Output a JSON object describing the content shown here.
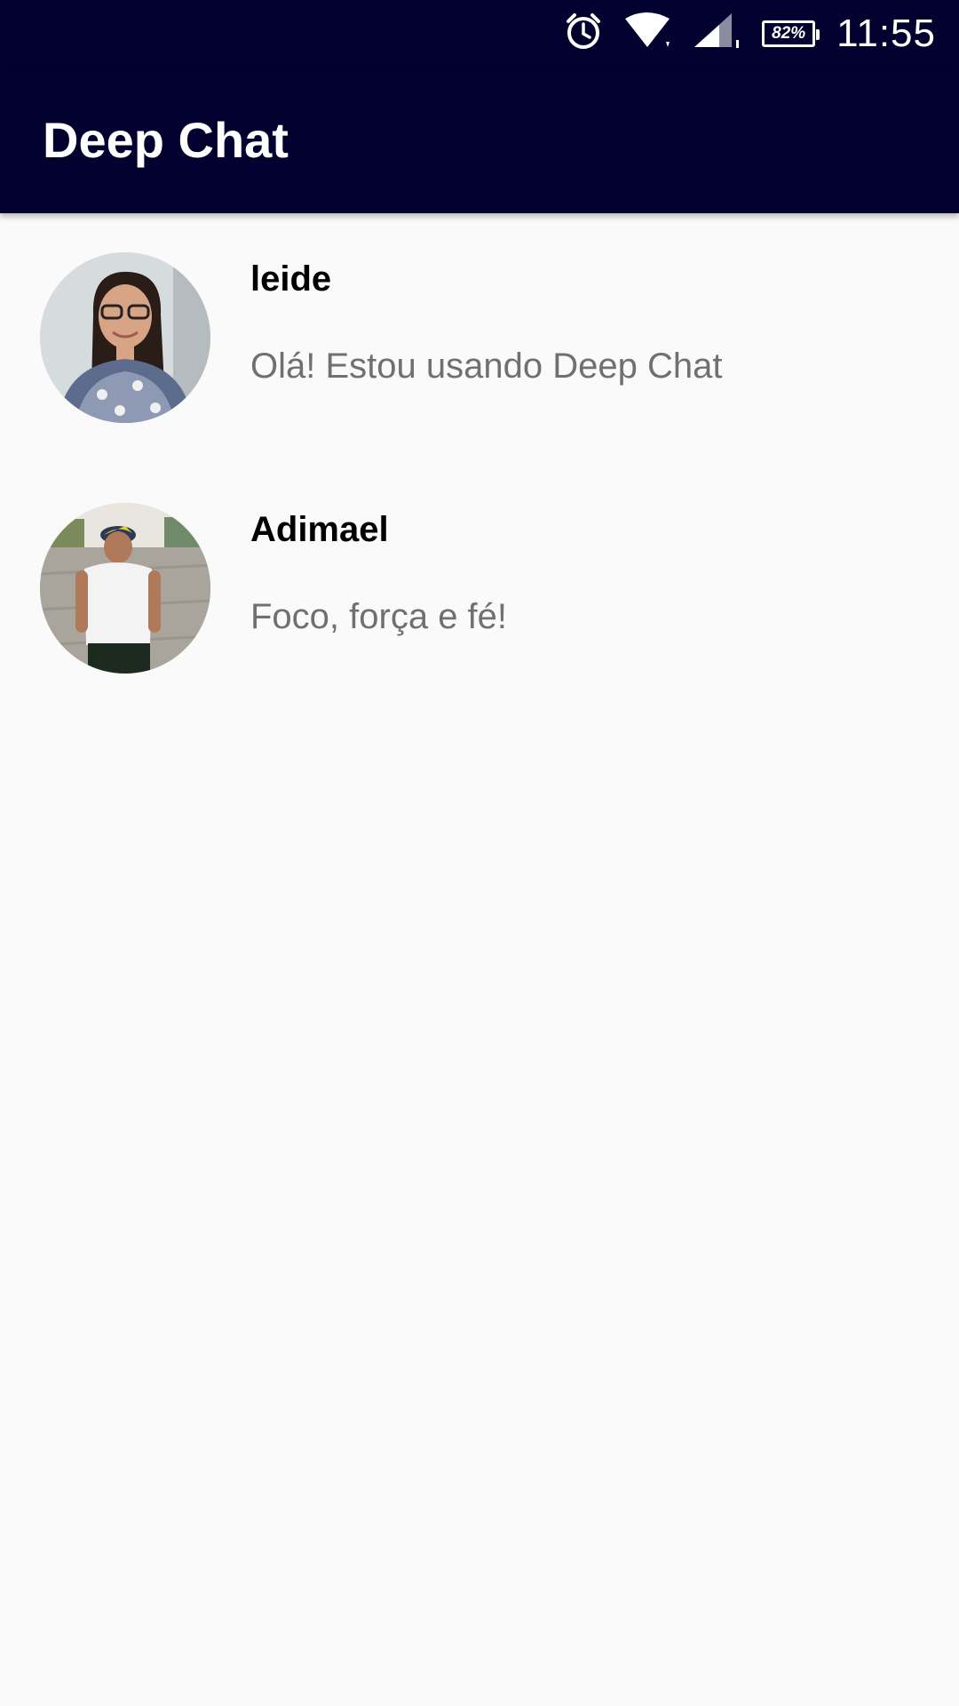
{
  "status_bar": {
    "battery_percent": "82%",
    "time": "11:55",
    "icons": [
      "alarm-icon",
      "wifi-icon",
      "cell-signal-icon",
      "battery-icon"
    ]
  },
  "app_bar": {
    "title": "Deep Chat"
  },
  "chats": [
    {
      "name": "leide",
      "status": "Olá! Estou usando Deep Chat"
    },
    {
      "name": "Adimael",
      "status": "Foco, força e fé!"
    }
  ],
  "colors": {
    "app_bar_bg": "#02002e",
    "background": "#fafafa",
    "status_text": "#707070"
  }
}
